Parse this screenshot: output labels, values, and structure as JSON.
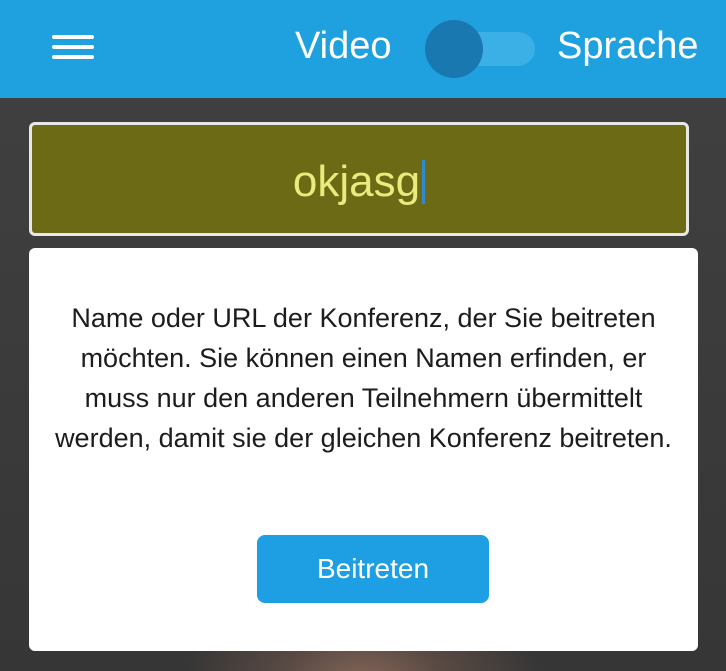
{
  "header": {
    "video_label": "Video",
    "speech_label": "Sprache",
    "mode": "Video"
  },
  "room": {
    "value": "okjasg"
  },
  "info": {
    "text": "Name oder URL der Konferenz, der Sie beitreten möchten. Sie können einen Namen erfinden, er muss nur den anderen Teilnehmern übermittelt werden, damit sie der gleichen Konferenz beitreten.",
    "join_label": "Beitreten"
  },
  "icons": {
    "menu": "hamburger-menu-icon"
  },
  "colors": {
    "header": "#1fa1e0",
    "toggle_knob": "#1a78b0",
    "room_field_bg": "#6d6a16",
    "room_field_text": "#e8ec7c",
    "button": "#1e9ee3"
  }
}
